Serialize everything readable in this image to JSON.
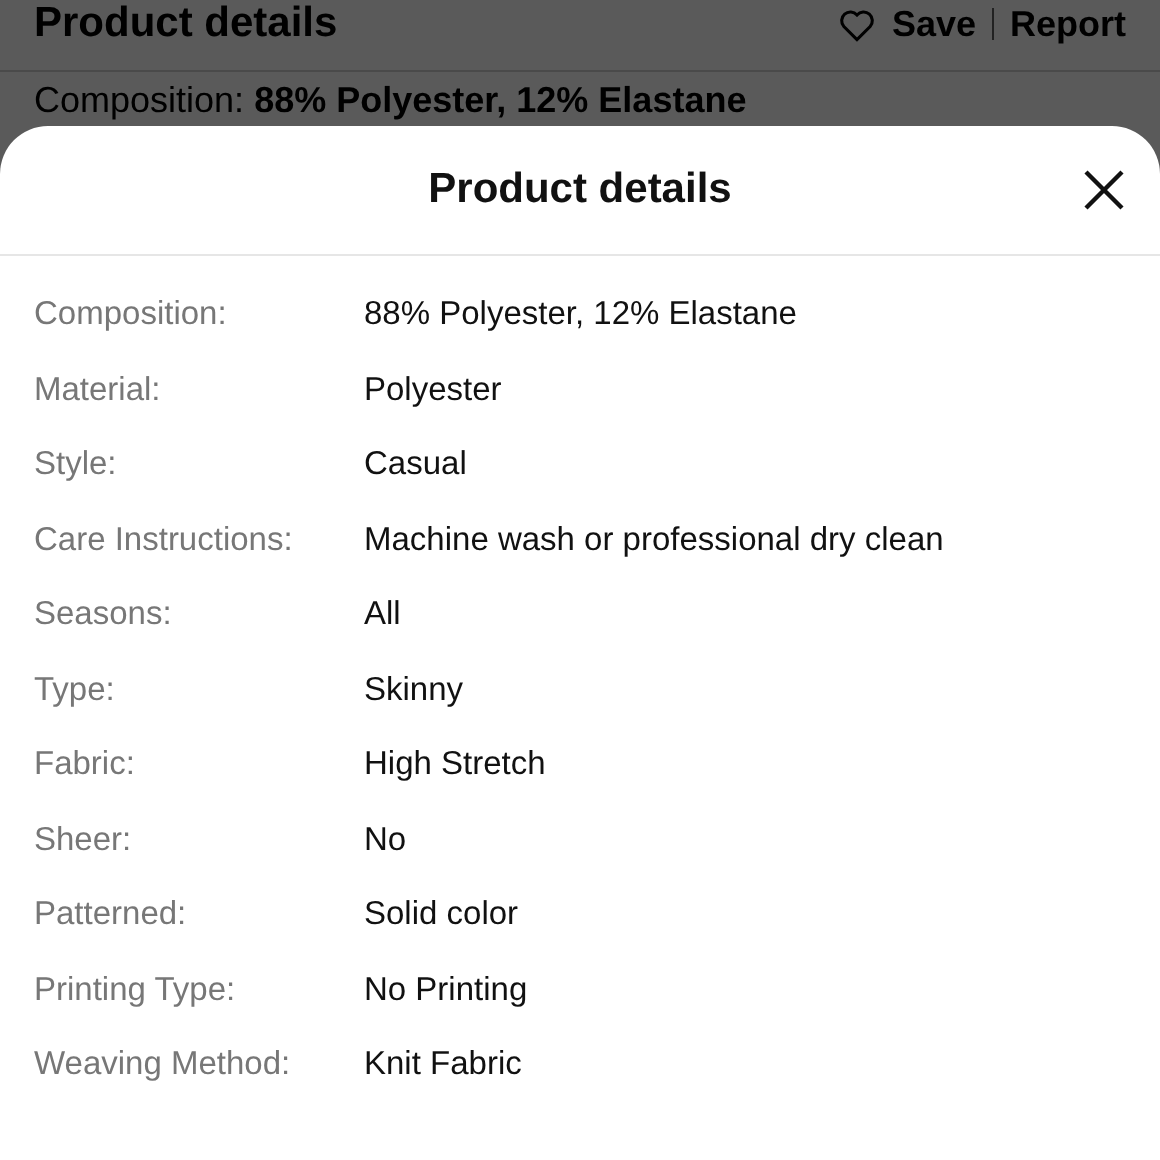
{
  "background_page": {
    "title": "Product details",
    "save_label": "Save",
    "report_label": "Report",
    "first_detail": {
      "label": "Composition:",
      "value": "88% Polyester, 12% Elastane"
    }
  },
  "sheet": {
    "title": "Product details",
    "details": [
      {
        "label": "Composition:",
        "value": "88% Polyester, 12% Elastane"
      },
      {
        "label": "Material:",
        "value": "Polyester"
      },
      {
        "label": "Style:",
        "value": "Casual"
      },
      {
        "label": "Care Instructions:",
        "value": "Machine wash or professional dry clean"
      },
      {
        "label": "Seasons:",
        "value": "All"
      },
      {
        "label": "Type:",
        "value": "Skinny"
      },
      {
        "label": "Fabric:",
        "value": "High Stretch"
      },
      {
        "label": "Sheer:",
        "value": "No"
      },
      {
        "label": "Patterned:",
        "value": "Solid color"
      },
      {
        "label": "Printing Type:",
        "value": "No Printing"
      },
      {
        "label": "Weaving Method:",
        "value": "Knit Fabric"
      }
    ]
  }
}
